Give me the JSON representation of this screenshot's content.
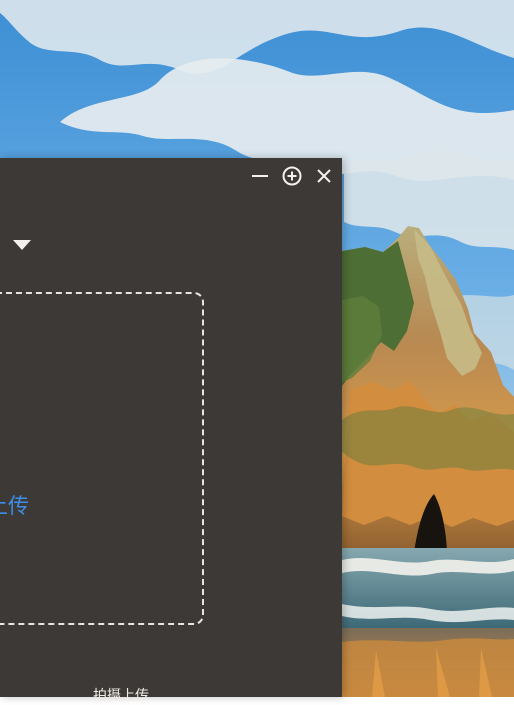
{
  "window": {
    "minimize_icon": "minimize-icon",
    "maximize_icon": "maximize-icon",
    "close_icon": "close-icon",
    "dropdown_icon": "triangle-down-icon"
  },
  "upload": {
    "label": "上传"
  },
  "footer": {
    "label": "拍摄上传"
  },
  "colors": {
    "panel_bg": "#3d3936",
    "accent_blue": "#3d8ee8",
    "dashed_border": "#e7e4e1"
  }
}
